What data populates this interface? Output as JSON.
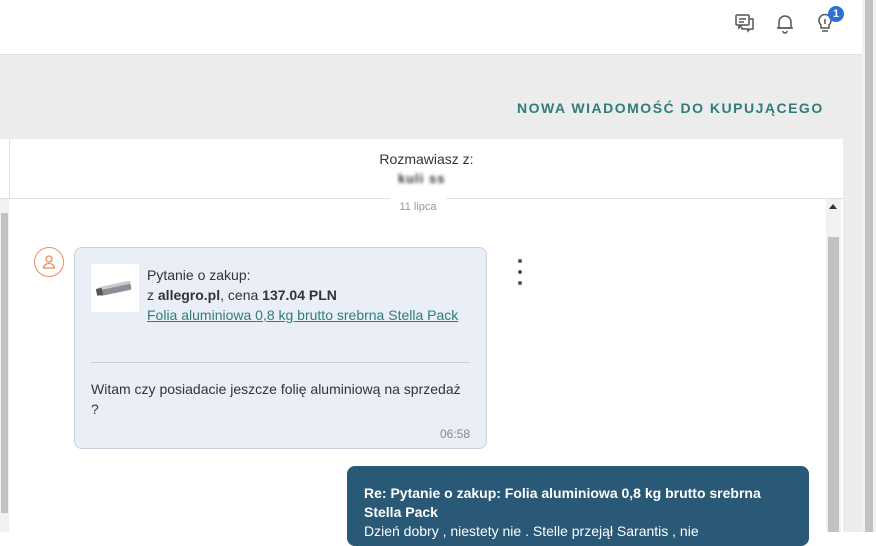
{
  "header": {
    "icons": [
      "chat-icon",
      "bell-icon",
      "lightbulb-icon"
    ],
    "notification_count": "1"
  },
  "actions": {
    "new_message_label": "NOWA WIADOMOŚĆ DO KUPUJĄCEGO"
  },
  "conversation": {
    "label": "Rozmawiasz z:",
    "user": "kuli ss",
    "date": "11 lipca"
  },
  "message": {
    "question_label": "Pytanie o zakup:",
    "from_prefix": "z ",
    "shop": "allegro.pl",
    "price_prefix": ", cena ",
    "price": "137.04 PLN",
    "product_link": "Folia aluminiowa 0,8 kg brutto srebrna Stella Pack",
    "body": "Witam czy posiadacie jeszcze folię aluminiową na sprzedaż ?",
    "time": "06:58"
  },
  "reply": {
    "title": "Re: Pytanie o zakup: Folia aluminiowa 0,8 kg brutto srebrna Stella Pack",
    "body": "Dzień dobry , niestety nie . Stelle przejął Sarantis , nie"
  },
  "colors": {
    "accent": "#2f7d7a",
    "reply_bg": "#2a5877",
    "bubble_bg": "#eaeef6",
    "avatar": "#f08a5d",
    "badge": "#2e6fd9"
  }
}
